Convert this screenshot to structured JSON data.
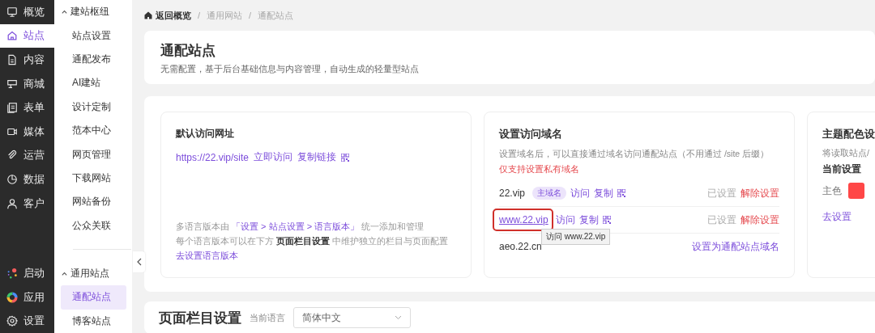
{
  "nav": [
    {
      "label": "概览",
      "selected": false
    },
    {
      "label": "站点",
      "selected": true
    },
    {
      "label": "内容",
      "selected": false
    },
    {
      "label": "商城",
      "selected": false
    },
    {
      "label": "表单",
      "selected": false
    },
    {
      "label": "媒体",
      "selected": false
    },
    {
      "label": "运营",
      "selected": false
    },
    {
      "label": "数据",
      "selected": false
    },
    {
      "label": "客户",
      "selected": false
    }
  ],
  "nav_bottom": [
    {
      "label": "启动"
    },
    {
      "label": "应用"
    },
    {
      "label": "设置"
    }
  ],
  "subnav": [
    {
      "title": "建站枢纽",
      "expanded": true,
      "items": [
        {
          "label": "站点设置",
          "selected": false
        },
        {
          "label": "通配发布",
          "selected": false
        },
        {
          "label": "AI建站",
          "selected": false
        },
        {
          "label": "设计定制",
          "selected": false
        },
        {
          "label": "范本中心",
          "selected": false
        },
        {
          "label": "网页管理",
          "selected": false
        },
        {
          "label": "下载网站",
          "selected": false
        },
        {
          "label": "网站备份",
          "selected": false
        },
        {
          "label": "公众关联",
          "selected": false
        }
      ]
    },
    {
      "title": "通用站点",
      "expanded": true,
      "items": [
        {
          "label": "通配站点",
          "selected": true
        },
        {
          "label": "博客站点",
          "selected": false
        }
      ]
    }
  ],
  "breadcrumb": [
    "返回概览",
    "通用网站",
    "通配站点"
  ],
  "breadcrumb_separator": "/",
  "header": {
    "title": "通配站点",
    "subtitle": "无需配置，基于后台基础信息与内容管理，自动生成的轻量型站点"
  },
  "default_url": {
    "title": "默认访问网址",
    "url": "https://22.vip/site",
    "actions": [
      "立即访问",
      "复制链接"
    ],
    "note_1": {
      "before": "多语言版本由",
      "link": "「设置 > 站点设置 > 语言版本」",
      "after": "统一添加和管理"
    },
    "note_2": "每个语言版本可以在下方 **页面栏目设置** 中维护独立的栏目与页面配置",
    "link": "去设置语言版本"
  },
  "domains": {
    "title": "设置访问域名",
    "desc": "设置域名后，可以直接通过域名访问通配站点（不用通过 /site 后缀）",
    "warning": "仅支持设置私有域名",
    "rows": [
      {
        "kind": "set",
        "domain": "22.vip",
        "hovered": false,
        "badge": "主域名",
        "actions": [
          "访问",
          "复制"
        ],
        "status": "已设置",
        "remove": "解除设置"
      },
      {
        "kind": "set",
        "domain": "www.22.vip",
        "hovered": true,
        "actions": [
          "访问",
          "复制"
        ],
        "status": "已设置",
        "remove": "解除设置"
      },
      {
        "kind": "unset",
        "domain": "aeo.22.cn",
        "hovered": false,
        "action": "设置为通配站点域名"
      }
    ],
    "tooltip": "访问 www.22.vip"
  },
  "theme": {
    "title": "主题配色设",
    "desc": "将读取站点/",
    "current": "当前设置",
    "primary_label": "主色",
    "color": "#ff4747",
    "link": "去设置"
  },
  "page_section": {
    "title": "页面栏目设置",
    "lang_label": "当前语言",
    "lang_value": "简体中文"
  }
}
